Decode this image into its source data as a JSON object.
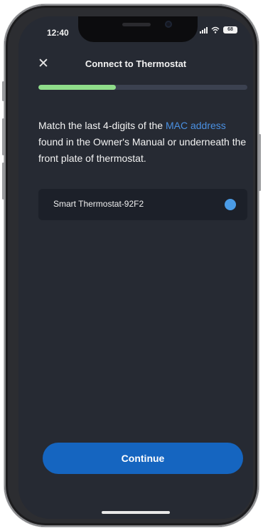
{
  "status_bar": {
    "time": "12:40",
    "battery": "68"
  },
  "header": {
    "title": "Connect to Thermostat"
  },
  "progress": {
    "fraction": 0.37
  },
  "instruction": {
    "before_link": "Match the last 4-digits of the ",
    "link_text": "MAC address",
    "after_link": " found in the Owner's Manual or underneath the front plate of thermostat."
  },
  "device": {
    "name": "Smart Thermostat-92F2",
    "selected": true
  },
  "continue_button": {
    "label": "Continue"
  },
  "colors": {
    "accent": "#1565c0",
    "progress": "#8fdd8a",
    "link": "#4a90e2"
  }
}
